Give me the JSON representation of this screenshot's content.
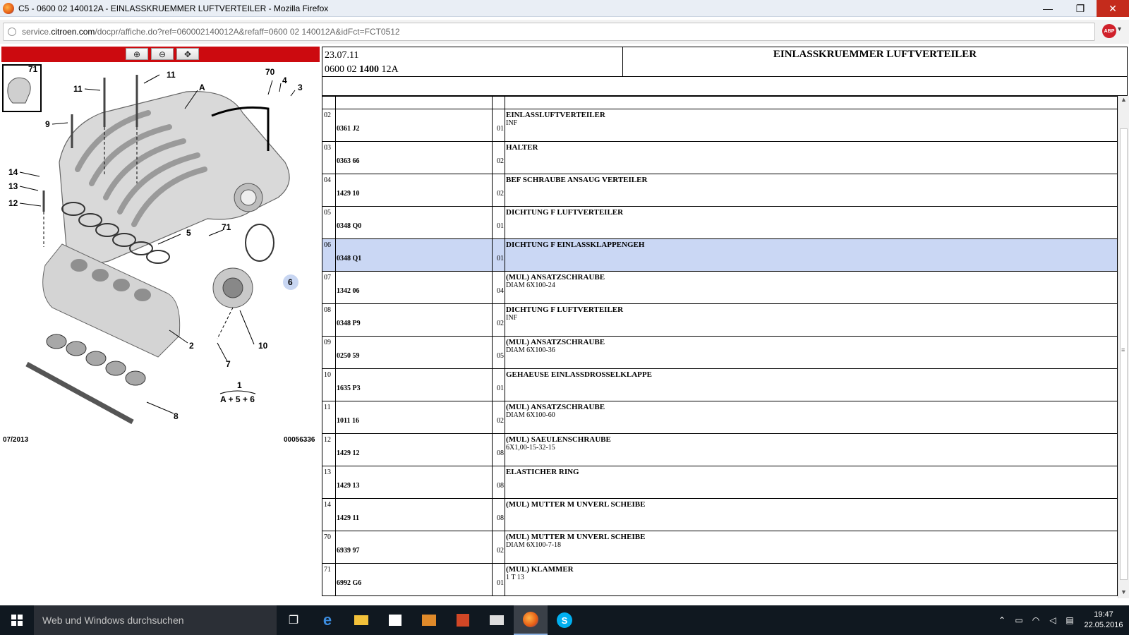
{
  "window": {
    "title": "C5 - 0600 02 140012A - EINLASSKRUEMMER LUFTVERTEILER - Mozilla Firefox",
    "min_glyph": "—",
    "max_glyph": "❐",
    "close_glyph": "✕"
  },
  "url": {
    "prefix": "service.",
    "domain": "citroen.com",
    "path": "/docpr/affiche.do?ref=060002140012A&refaff=0600 02 140012A&idFct=FCT0512",
    "abp_label": "ABP"
  },
  "diagram": {
    "date_code": "07/2013",
    "drawing_number": "00056336",
    "thumb_label": "71",
    "formula_top": "1",
    "formula_bottom": "A + 5 + 6",
    "labels": [
      "11",
      "11",
      "A",
      "70",
      "4",
      "3",
      "9",
      "14",
      "13",
      "12",
      "5",
      "71",
      "6",
      "2",
      "10",
      "7",
      "8"
    ]
  },
  "header": {
    "date": "23.07.11",
    "ref_pre": "0600 02 ",
    "ref_bold": "1400",
    "ref_post": " 12A",
    "title": "EINLASSKRUEMMER LUFTVERTEILER"
  },
  "parts": [
    {
      "pos": "02",
      "ref": "0361 J2",
      "qty": "01",
      "desc": "EINLASSLUFTVERTEILER",
      "desc2": "INF",
      "selected": false
    },
    {
      "pos": "03",
      "ref": "0363 66",
      "qty": "02",
      "desc": "HALTER",
      "desc2": "",
      "selected": false
    },
    {
      "pos": "04",
      "ref": "1429 10",
      "qty": "02",
      "desc": "BEF SCHRAUBE ANSAUG VERTEILER",
      "desc2": "",
      "selected": false
    },
    {
      "pos": "05",
      "ref": "0348 Q0",
      "qty": "01",
      "desc": "DICHTUNG F LUFTVERTEILER",
      "desc2": "",
      "selected": false
    },
    {
      "pos": "06",
      "ref": "0348 Q1",
      "qty": "01",
      "desc": "DICHTUNG F EINLASSKLAPPENGEH",
      "desc2": "",
      "selected": true
    },
    {
      "pos": "07",
      "ref": "1342 06",
      "qty": "04",
      "desc": "(MUL) ANSATZSCHRAUBE",
      "desc2": "DIAM 6X100-24",
      "selected": false
    },
    {
      "pos": "08",
      "ref": "0348 P9",
      "qty": "02",
      "desc": "DICHTUNG F LUFTVERTEILER",
      "desc2": "INF",
      "selected": false
    },
    {
      "pos": "09",
      "ref": "0250 59",
      "qty": "05",
      "desc": "(MUL) ANSATZSCHRAUBE",
      "desc2": "DIAM 6X100-36",
      "selected": false
    },
    {
      "pos": "10",
      "ref": "1635 P3",
      "qty": "01",
      "desc": "GEHAEUSE EINLASSDROSSELKLAPPE",
      "desc2": "",
      "selected": false
    },
    {
      "pos": "11",
      "ref": "1011 16",
      "qty": "02",
      "desc": "(MUL) ANSATZSCHRAUBE",
      "desc2": "DIAM 6X100-60",
      "selected": false
    },
    {
      "pos": "12",
      "ref": "1429 12",
      "qty": "08",
      "desc": "(MUL) SAEULENSCHRAUBE",
      "desc2": "6X1,00-15-32-15",
      "selected": false
    },
    {
      "pos": "13",
      "ref": "1429 13",
      "qty": "08",
      "desc": "ELASTICHER RING",
      "desc2": "",
      "selected": false
    },
    {
      "pos": "14",
      "ref": "1429 11",
      "qty": "08",
      "desc": "(MUL) MUTTER M UNVERL SCHEIBE",
      "desc2": "",
      "selected": false
    },
    {
      "pos": "70",
      "ref": "6939 97",
      "qty": "02",
      "desc": "(MUL) MUTTER M UNVERL SCHEIBE",
      "desc2": "DIAM 6X100-7-18",
      "selected": false
    },
    {
      "pos": "71",
      "ref": "6992 G6",
      "qty": "01",
      "desc": "(MUL) KLAMMER",
      "desc2": "1 T 13",
      "selected": false
    }
  ],
  "taskbar": {
    "search_placeholder": "Web und Windows durchsuchen",
    "time": "19:47",
    "date": "22.05.2016"
  }
}
